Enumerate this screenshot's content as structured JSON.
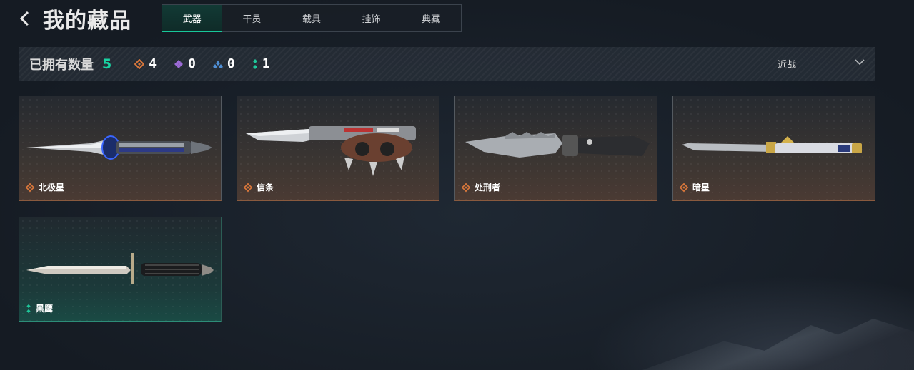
{
  "header": {
    "title": "我的藏品",
    "tabs": [
      {
        "label": "武器",
        "active": true
      },
      {
        "label": "干员"
      },
      {
        "label": "载具"
      },
      {
        "label": "挂饰"
      },
      {
        "label": "典藏"
      }
    ]
  },
  "stats": {
    "owned_label": "已拥有数量",
    "owned_count": "5",
    "rarity_counts": [
      {
        "icon": "orange-diamond-icon",
        "color": "#d9773b",
        "value": "4"
      },
      {
        "icon": "purple-diamond-icon",
        "color": "#9b6ad6",
        "value": "0"
      },
      {
        "icon": "blue-triangle-icon",
        "color": "#4f8fd6",
        "value": "0"
      },
      {
        "icon": "green-dots-icon",
        "color": "#1fc79a",
        "value": "1"
      }
    ],
    "filter_label": "近战"
  },
  "colors": {
    "accent": "#19d3a2",
    "rarity_orange": "#d9773b",
    "rarity_green": "#1fc79a"
  },
  "items": [
    {
      "name": "北极星",
      "rarity": "orange",
      "icon": "orange-diamond-icon"
    },
    {
      "name": "信条",
      "rarity": "orange",
      "icon": "orange-diamond-icon"
    },
    {
      "name": "处刑者",
      "rarity": "orange",
      "icon": "orange-diamond-icon"
    },
    {
      "name": "暗星",
      "rarity": "orange",
      "icon": "orange-diamond-icon"
    },
    {
      "name": "黑鹰",
      "rarity": "green",
      "icon": "green-dots-icon"
    }
  ]
}
